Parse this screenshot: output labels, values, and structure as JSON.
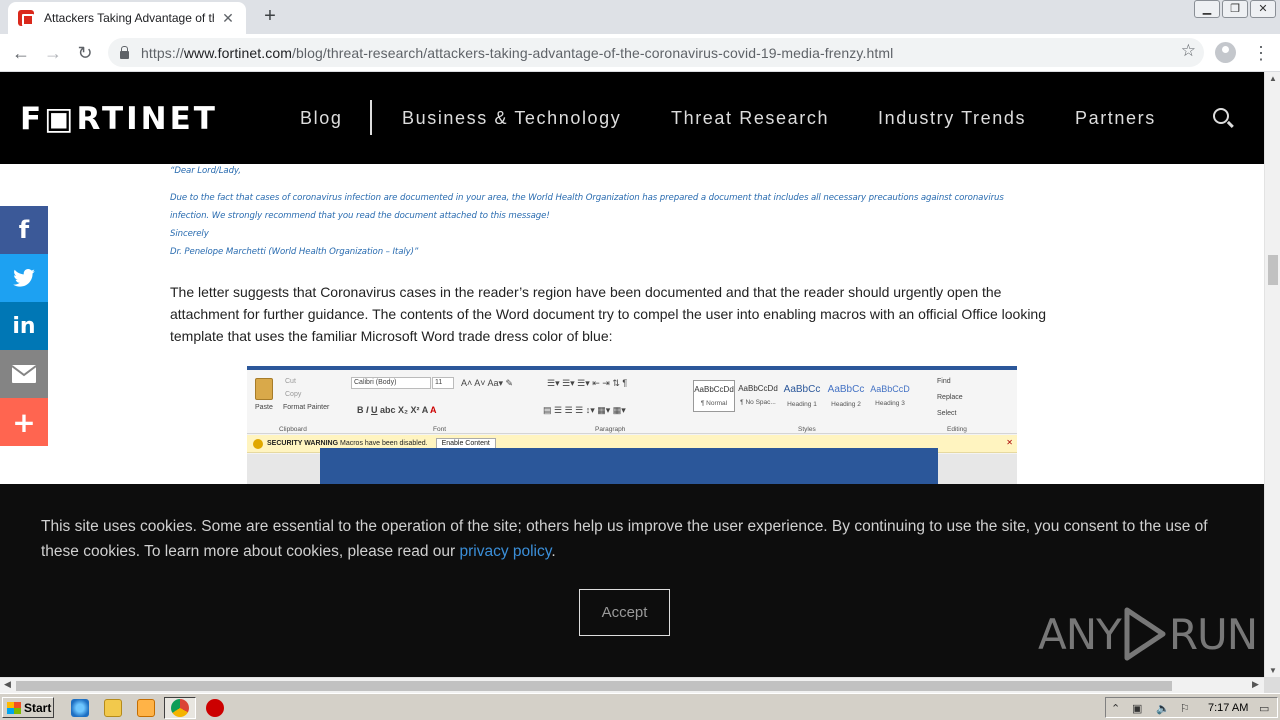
{
  "browser": {
    "tab_title": "Attackers Taking Advantage of the C",
    "url_scheme": "https://",
    "url_host": "www.fortinet.com",
    "url_path": "/blog/threat-research/attackers-taking-advantage-of-the-coronavirus-covid-19-media-frenzy.html"
  },
  "site": {
    "logo": "F▣RTINET",
    "nav": [
      "Blog",
      "Business & Technology",
      "Threat Research",
      "Industry Trends",
      "Partners"
    ]
  },
  "article": {
    "quote_lines": [
      "“Dear Lord/Lady,",
      "Due to the fact that cases of coronavirus infection are documented in your area, the World Health Organization has prepared a document that includes all necessary precautions against coronavirus",
      "infection. We strongly recommend that you read the document attached to this message!",
      "Sincerely",
      "Dr. Penelope Marchetti (World Health Organization – Italy)”"
    ],
    "paragraph": "The letter suggests that Coronavirus cases in the reader’s region have been documented and that the reader should urgently open the attachment for further guidance. The contents of the Word document try to compel the user into enabling macros with an official Office looking template that uses the familiar Microsoft Word trade dress color of blue:"
  },
  "word_ribbon": {
    "cut": "Cut",
    "copy": "Copy",
    "format_painter": "Format Painter",
    "paste": "Paste",
    "font_name": "Calibri (Body)",
    "font_size": "11",
    "group_labels": [
      "Clipboard",
      "Font",
      "Paragraph",
      "Styles",
      "Editing"
    ],
    "styles": [
      {
        "sample": "AaBbCcDd",
        "name": "¶ Normal"
      },
      {
        "sample": "AaBbCcDd",
        "name": "¶ No Spac..."
      },
      {
        "sample": "AaBbCc",
        "name": "Heading 1"
      },
      {
        "sample": "AaBbCc",
        "name": "Heading 2"
      },
      {
        "sample": "AaBbCcD",
        "name": "Heading 3"
      }
    ],
    "find": "Find",
    "replace": "Replace",
    "select": "Select",
    "security_label": "SECURITY WARNING",
    "security_text": "Macros have been disabled.",
    "enable_button": "Enable Content"
  },
  "social": {
    "facebook": "f",
    "linkedin": "in",
    "more": "+",
    "colors": {
      "facebook": "#3b5998",
      "twitter": "#1da1f2",
      "linkedin": "#0077b5",
      "email": "#848484",
      "more": "#ff6550"
    }
  },
  "cookie": {
    "text_before": "This site uses cookies. Some are essential to the operation of the site; others help us improve the user experience. By continuing to use the site, you consent to the use of these cookies. To learn more about cookies, please read our ",
    "link_text": "privacy policy",
    "text_after": ".",
    "accept_label": "Accept"
  },
  "watermark": {
    "left": "ANY",
    "right": "RUN"
  },
  "taskbar": {
    "start_label": "Start",
    "clock": "7:17 AM"
  }
}
